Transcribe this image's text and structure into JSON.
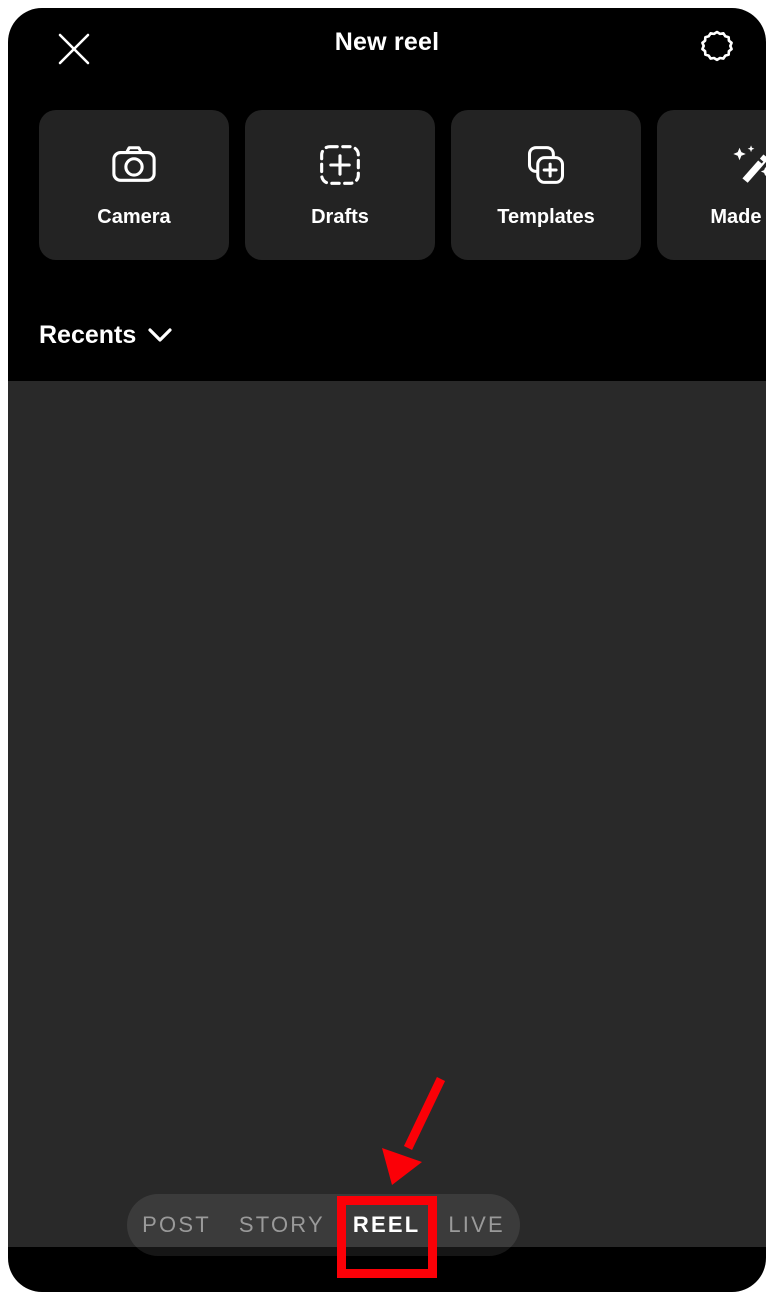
{
  "header": {
    "title": "New reel",
    "close_icon": "close-icon",
    "settings_icon": "gear-icon"
  },
  "chips": [
    {
      "label": "Camera",
      "icon": "camera-icon"
    },
    {
      "label": "Drafts",
      "icon": "dashed-square-plus-icon"
    },
    {
      "label": "Templates",
      "icon": "layers-plus-icon"
    },
    {
      "label": "Made for",
      "icon": "magic-wand-icon"
    }
  ],
  "gallery": {
    "source_label": "Recents",
    "chevron_icon": "chevron-down-icon"
  },
  "mode_selector": {
    "items": [
      {
        "label": "POST",
        "active": false
      },
      {
        "label": "STORY",
        "active": false
      },
      {
        "label": "REEL",
        "active": true
      },
      {
        "label": "LIVE",
        "active": false
      }
    ]
  },
  "annotation": {
    "highlight_target": "REEL",
    "box_color": "#fb0007",
    "arrow_color": "#fb0007"
  },
  "colors": {
    "screen_background": "#000000",
    "chip_background": "#232323",
    "gallery_background": "#292929",
    "text_primary": "#ffffff",
    "text_muted": "#9a9a9a",
    "annotation_red": "#fb0007"
  }
}
